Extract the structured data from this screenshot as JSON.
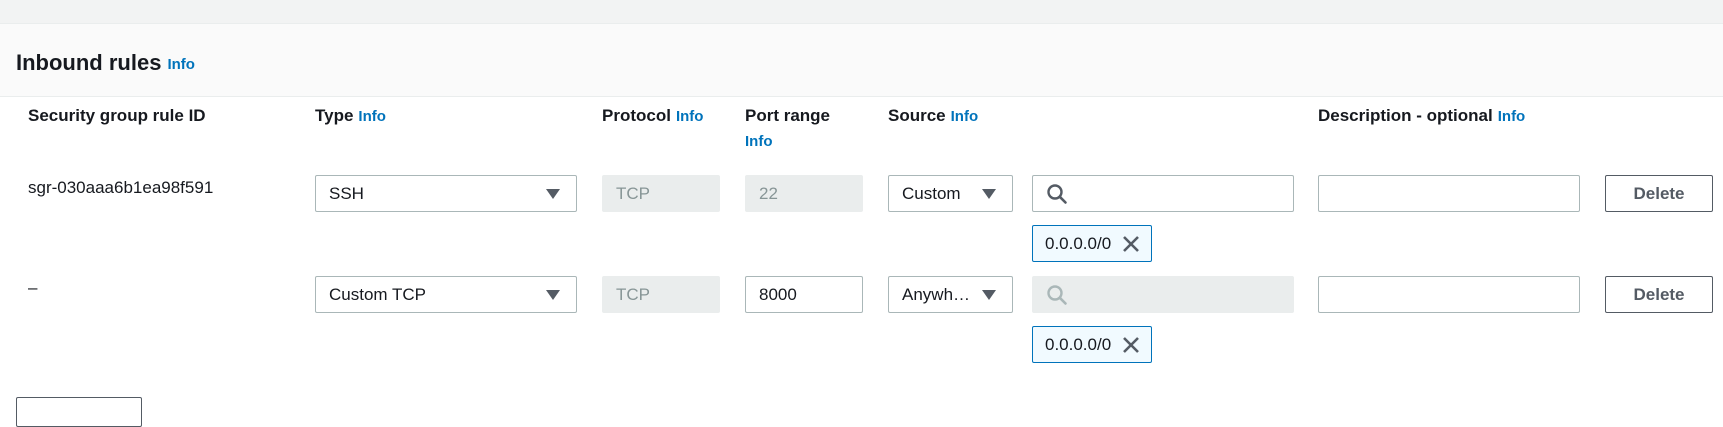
{
  "section": {
    "title": "Inbound rules",
    "info": "Info"
  },
  "columns": {
    "rule_id": "Security group rule ID",
    "type": "Type",
    "protocol": "Protocol",
    "port_range": "Port range",
    "source": "Source",
    "description": "Description - optional",
    "info": "Info"
  },
  "rules": [
    {
      "rule_id": "sgr-030aaa6b1ea98f591",
      "type": "SSH",
      "protocol": "TCP",
      "port_range": "22",
      "port_editable": false,
      "source_type": "Custom",
      "search_value": "",
      "token": "0.0.0.0/0",
      "description": "",
      "delete_label": "Delete"
    },
    {
      "rule_id": "–",
      "type": "Custom TCP",
      "protocol": "TCP",
      "port_range": "8000",
      "port_editable": true,
      "source_type": "Anywh…",
      "search_value": "",
      "token": "0.0.0.0/0",
      "description": "",
      "delete_label": "Delete"
    }
  ],
  "colors": {
    "link": "#0073bb",
    "token_border": "#0073bb",
    "disabled_bg": "#eaeded"
  }
}
